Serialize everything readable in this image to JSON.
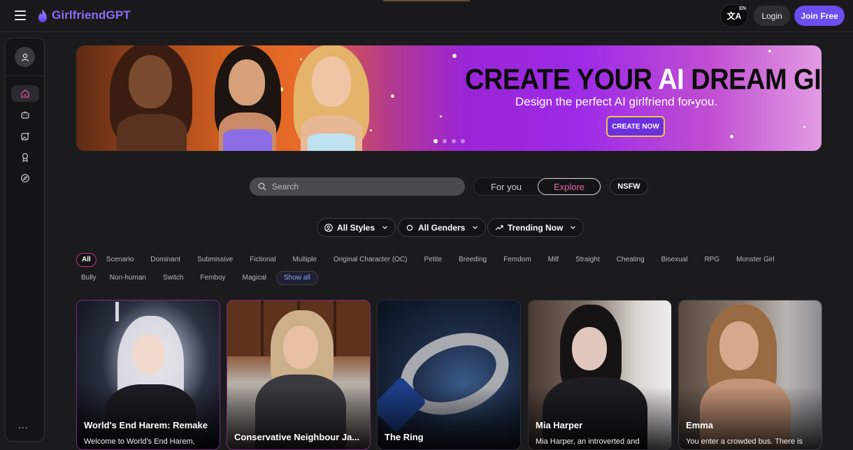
{
  "header": {
    "logo_text": "GirlfriendGPT",
    "lang_icon": "translate-icon",
    "lang_code": "EN",
    "login_label": "Login",
    "join_label": "Join Free",
    "brand_color": "#6a4ef0"
  },
  "sidebar": {
    "items": [
      {
        "icon": "user-icon"
      },
      {
        "icon": "home-icon"
      },
      {
        "icon": "bot-icon"
      },
      {
        "icon": "image-generate-icon"
      },
      {
        "icon": "award-icon"
      },
      {
        "icon": "compass-icon"
      }
    ],
    "more_label": "..."
  },
  "banner": {
    "title_pre": "CREATE YOUR ",
    "title_highlight": "AI",
    "title_post": " DREAM GIRL",
    "subtitle": "Design the perfect AI girlfriend for you.",
    "cta_label": "CREATE NOW",
    "slide_count": 4,
    "active_slide": 1
  },
  "search": {
    "placeholder": "Search"
  },
  "feed_toggle": {
    "for_you_label": "For you",
    "explore_label": "Explore",
    "selected": "Explore"
  },
  "nsfw_label": "NSFW",
  "filters": {
    "styles_label": "All Styles",
    "genders_label": "All Genders",
    "sort_label": "Trending Now"
  },
  "tags": {
    "row1": [
      "All",
      "Scenario",
      "Dominant",
      "Submissive",
      "Fictional",
      "Multiple",
      "Original Character (OC)",
      "Petite",
      "Breeding",
      "Femdom",
      "Milf",
      "Straight",
      "Cheating",
      "Bisexual",
      "RPG",
      "Monster Girl"
    ],
    "row2": [
      "Bully",
      "Non-human",
      "Switch",
      "Femboy",
      "Magical"
    ],
    "show_all_label": "Show all",
    "selected": "All"
  },
  "cards": [
    {
      "name": "World's End Harem: Remake",
      "desc": "Welcome to World's End Harem,"
    },
    {
      "name": "Conservative Neighbour Ja...",
      "desc": ""
    },
    {
      "name": "The Ring",
      "desc": ""
    },
    {
      "name": "Mia Harper",
      "desc": "Mia Harper, an introverted and"
    },
    {
      "name": "Emma",
      "desc": "You enter a crowded bus. There is"
    }
  ]
}
